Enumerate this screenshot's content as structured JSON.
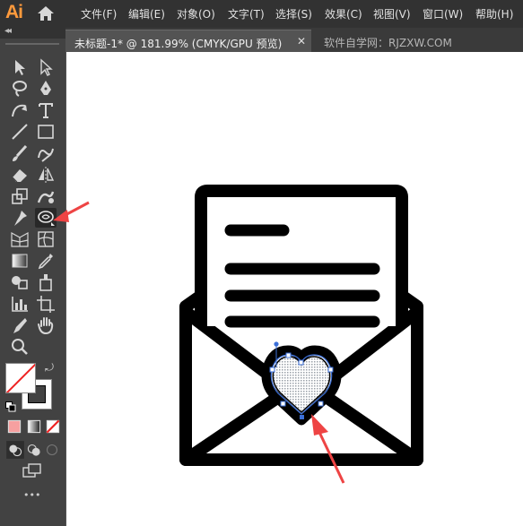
{
  "app": {
    "logo": "Ai",
    "menu": [
      {
        "label": "文件(F)"
      },
      {
        "label": "编辑(E)"
      },
      {
        "label": "对象(O)"
      },
      {
        "label": "文字(T)"
      },
      {
        "label": "选择(S)"
      },
      {
        "label": "效果(C)"
      },
      {
        "label": "视图(V)"
      },
      {
        "label": "窗口(W)"
      },
      {
        "label": "帮助(H)"
      }
    ]
  },
  "tabs": {
    "active": "未标题-1* @ 181.99% (CMYK/GPU 预览)",
    "close": "✕",
    "other": "软件自学网：RJZXW.COM"
  },
  "toolbar": {
    "collapse": "◂◂",
    "active_tool": "pucker-tool",
    "tools": [
      "selection-tool",
      "direct-selection-tool",
      "lasso-tool",
      "pen-tool",
      "curvature-tool",
      "type-tool",
      "line-tool",
      "rectangle-tool",
      "paintbrush-tool",
      "shaper-tool",
      "eraser-tool",
      "reflect-tool",
      "scale-tool",
      "warp-tool",
      "puppet-warp-tool",
      "pucker-tool",
      "mesh-tool",
      "perspective-grid-tool",
      "gradient-tool",
      "eyedropper-tool",
      "shape-builder-tool",
      "live-paint-tool",
      "graph-tool",
      "artboard-tool",
      "slice-tool",
      "hand-tool",
      "zoom-tool"
    ],
    "fill_color": "#ffffff",
    "stroke_color": "#000000",
    "more": "•••"
  },
  "colors": {
    "accent_arrow": "#ee4444",
    "selection": "#3b6fd8",
    "artwork": "#000000"
  }
}
